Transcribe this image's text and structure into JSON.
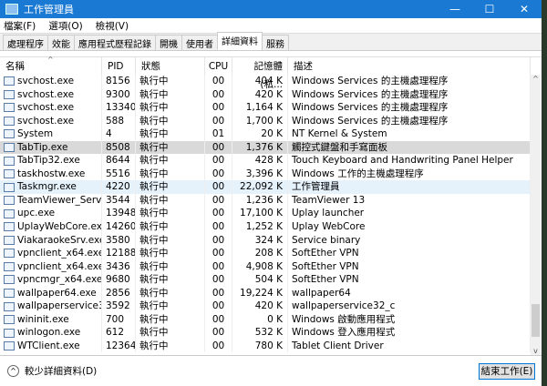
{
  "window": {
    "title": "工作管理員",
    "minimize": "—",
    "maximize": "☐",
    "close": "✕"
  },
  "menu": [
    "檔案(F)",
    "選項(O)",
    "檢視(V)"
  ],
  "tabs": [
    {
      "label": "處理程序"
    },
    {
      "label": "效能"
    },
    {
      "label": "應用程式歷程記錄"
    },
    {
      "label": "開機"
    },
    {
      "label": "使用者"
    },
    {
      "label": "詳細資料",
      "active": true
    },
    {
      "label": "服務"
    }
  ],
  "columns": {
    "name": "名稱",
    "pid": "PID",
    "status": "狀態",
    "cpu": "CPU",
    "memory": "記憶體 (私...",
    "description": "描述"
  },
  "rows": [
    [
      "svchost.exe",
      "8156",
      "執行中",
      "00",
      "404 K",
      "Windows Services 的主機處理程序"
    ],
    [
      "svchost.exe",
      "9300",
      "執行中",
      "00",
      "420 K",
      "Windows Services 的主機處理程序"
    ],
    [
      "svchost.exe",
      "13340",
      "執行中",
      "00",
      "1,164 K",
      "Windows Services 的主機處理程序"
    ],
    [
      "svchost.exe",
      "588",
      "執行中",
      "00",
      "1,700 K",
      "Windows Services 的主機處理程序"
    ],
    [
      "System",
      "4",
      "執行中",
      "01",
      "20 K",
      "NT Kernel & System"
    ],
    [
      "TabTip.exe",
      "8508",
      "執行中",
      "00",
      "1,376 K",
      "觸控式鍵盤和手寫面板"
    ],
    [
      "TabTip32.exe",
      "8644",
      "執行中",
      "00",
      "428 K",
      "Touch Keyboard and Handwriting Panel Helper"
    ],
    [
      "taskhostw.exe",
      "5516",
      "執行中",
      "00",
      "3,396 K",
      "Windows 工作的主機處理程序"
    ],
    [
      "Taskmgr.exe",
      "4220",
      "執行中",
      "00",
      "22,092 K",
      "工作管理員"
    ],
    [
      "TeamViewer_Servic...",
      "3544",
      "執行中",
      "00",
      "1,236 K",
      "TeamViewer 13"
    ],
    [
      "upc.exe",
      "13948",
      "執行中",
      "00",
      "17,100 K",
      "Uplay launcher"
    ],
    [
      "UplayWebCore.exe",
      "14260",
      "執行中",
      "00",
      "1,252 K",
      "Uplay WebCore"
    ],
    [
      "ViakaraokeSrv.exe",
      "3580",
      "執行中",
      "00",
      "324 K",
      "Service binary"
    ],
    [
      "vpnclient_x64.exe",
      "12188",
      "執行中",
      "00",
      "208 K",
      "SoftEther VPN"
    ],
    [
      "vpnclient_x64.exe",
      "3436",
      "執行中",
      "00",
      "4,908 K",
      "SoftEther VPN"
    ],
    [
      "vpncmgr_x64.exe",
      "9680",
      "執行中",
      "00",
      "504 K",
      "SoftEther VPN"
    ],
    [
      "wallpaper64.exe",
      "2856",
      "執行中",
      "00",
      "19,224 K",
      "wallpaper64"
    ],
    [
      "wallpaperservice32...",
      "3592",
      "執行中",
      "00",
      "420 K",
      "wallpaperservice32_c"
    ],
    [
      "wininit.exe",
      "700",
      "執行中",
      "00",
      "0 K",
      "Windows 啟動應用程式"
    ],
    [
      "winlogon.exe",
      "612",
      "執行中",
      "00",
      "532 K",
      "Windows 登入應用程式"
    ],
    [
      "WTClient.exe",
      "12364",
      "執行中",
      "00",
      "780 K",
      "Tablet Client Driver"
    ]
  ],
  "selected_row": "TabTip.exe",
  "hovered_row": "Taskmgr.exe",
  "footer": {
    "fewer_details": "較少詳細資料(D)",
    "end_task": "結束工作(E)"
  },
  "colors": {
    "titlebar": "#1979d3",
    "selected": "#d9d9d9",
    "hover": "#e5f1fb",
    "button_border": "#0078d7"
  }
}
